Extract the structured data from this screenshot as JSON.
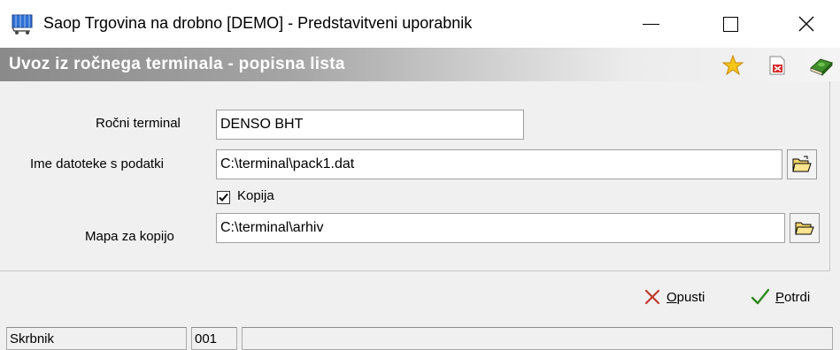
{
  "window": {
    "title": "Saop Trgovina na drobno [DEMO] - Predstavitveni uporabnik",
    "app_icon": "shopping-cart-icon",
    "controls": [
      "minimize-icon",
      "maximize-icon",
      "close-icon"
    ]
  },
  "header": {
    "title": "Uvoz iz ročnega terminala - popisna lista",
    "icons": [
      "star-icon",
      "pdf-document-icon",
      "help-book-icon"
    ]
  },
  "form": {
    "terminal": {
      "label": "Ročni terminal",
      "value": "DENSO BHT"
    },
    "datafile": {
      "label": "Ime datoteke s podatki",
      "value": "C:\\terminal\\pack1.dat",
      "button_icon": "open-file-icon"
    },
    "copy": {
      "label": "Kopija",
      "checked": true
    },
    "copy_folder": {
      "label": "Mapa za kopijo",
      "value": "C:\\terminal\\arhiv",
      "button_icon": "open-folder-icon"
    }
  },
  "buttons": {
    "cancel": {
      "label": "Opusti",
      "icon": "x-icon"
    },
    "confirm": {
      "label": "Potrdi",
      "icon": "checkmark-icon"
    }
  },
  "statusbar": {
    "user": "Skrbnik",
    "code": "001",
    "message": ""
  },
  "colors": {
    "cancel_x": "#c0392b",
    "confirm_check": "#2e8b1e",
    "header_text": "#ffffff"
  }
}
